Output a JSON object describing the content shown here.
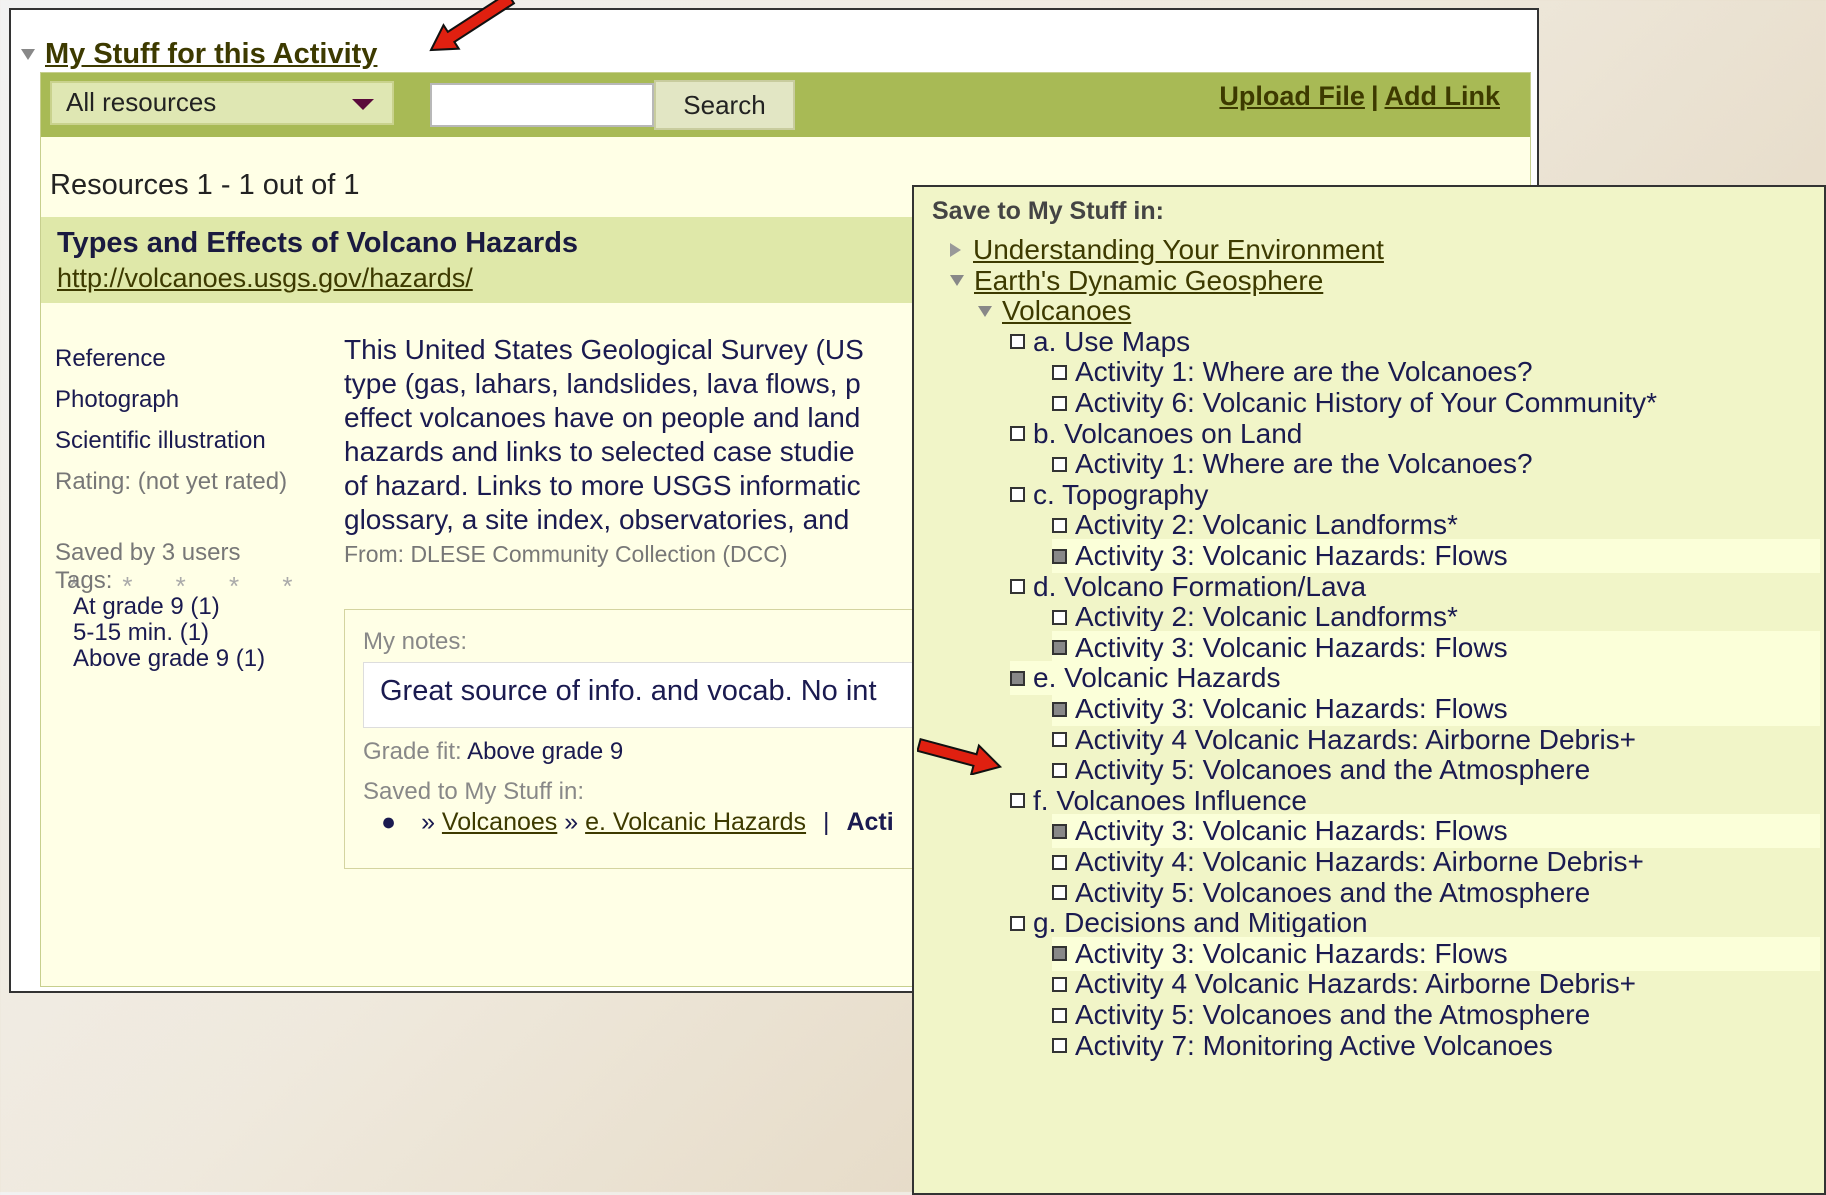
{
  "main": {
    "title": "My Stuff for this Activity",
    "toolbar": {
      "filter_value": "All resources",
      "search_value": "",
      "search_button": "Search",
      "upload_link": "Upload File",
      "separator": "|",
      "add_link": "Add Link"
    },
    "results_count": "Resources 1 - 1 out of 1",
    "result": {
      "title": "Types and Effects of Volcano Hazards",
      "url": "http://volcanoes.usgs.gov/hazards/",
      "types": [
        "Reference",
        "Photograph",
        "Scientific illustration"
      ],
      "rating": "Rating: (not yet rated)",
      "stars": "* * * * *",
      "rating_value": 0,
      "saved_by": "Saved by 3 users",
      "tags_label": "Tags:",
      "tags": [
        "At grade 9 (1)",
        "5-15 min. (1)",
        "Above grade 9 (1)"
      ],
      "description": "This United States Geological Survey (US\ntype (gas, lahars, landslides, lava flows, p\neffect volcanoes have on people and land\nhazards and links to selected case studie\nof hazard. Links to more USGS informatic\nglossary, a site index, observatories, and",
      "from": "From: DLESE Community Collection (DCC)",
      "notes": {
        "label": "My notes:",
        "text": "Great source of info. and vocab. No int",
        "grade_label": "Grade fit:",
        "grade_value": "Above grade 9",
        "saved_to_label": "Saved to My Stuff in:",
        "path_prefix": "»",
        "path_volcanoes": "Volcanoes",
        "path_sep": "»",
        "path_hazards": "e. Volcanic Hazards",
        "path_pipe": "|",
        "path_tail": "Acti"
      }
    }
  },
  "popup": {
    "title": "Save to My Stuff in:",
    "tree": [
      {
        "label": "Understanding Your Environment",
        "kind": "collapsed",
        "level": 0
      },
      {
        "label": "Earth's Dynamic Geosphere",
        "kind": "expanded",
        "level": 0
      },
      {
        "label": "Volcanoes",
        "kind": "expanded",
        "level": 1
      },
      {
        "label": "a. Use Maps",
        "kind": "check",
        "checked": false,
        "level": 2
      },
      {
        "label": "Activity 1: Where are the Volcanoes?",
        "kind": "check",
        "checked": false,
        "level": 3
      },
      {
        "label": "Activity 6: Volcanic History of Your Community*",
        "kind": "check",
        "checked": false,
        "level": 3
      },
      {
        "label": "b. Volcanoes on Land",
        "kind": "check",
        "checked": false,
        "level": 2
      },
      {
        "label": "Activity 1: Where are the Volcanoes?",
        "kind": "check",
        "checked": false,
        "level": 3
      },
      {
        "label": "c. Topography",
        "kind": "check",
        "checked": false,
        "level": 2
      },
      {
        "label": "Activity 2: Volcanic Landforms*",
        "kind": "check",
        "checked": false,
        "level": 3
      },
      {
        "label": "Activity 3: Volcanic Hazards: Flows",
        "kind": "check",
        "checked": true,
        "level": 3,
        "highlight": true
      },
      {
        "label": "d. Volcano Formation/Lava",
        "kind": "check",
        "checked": false,
        "level": 2
      },
      {
        "label": "Activity 2: Volcanic Landforms*",
        "kind": "check",
        "checked": false,
        "level": 3
      },
      {
        "label": "Activity 3: Volcanic Hazards: Flows",
        "kind": "check",
        "checked": true,
        "level": 3,
        "highlight": true
      },
      {
        "label": "e. Volcanic Hazards",
        "kind": "check",
        "checked": true,
        "level": 2,
        "highlight": true
      },
      {
        "label": "Activity 3: Volcanic Hazards: Flows",
        "kind": "check",
        "checked": true,
        "level": 3,
        "highlight": true
      },
      {
        "label": "Activity 4 Volcanic Hazards: Airborne Debris+",
        "kind": "check",
        "checked": false,
        "level": 3
      },
      {
        "label": "Activity 5: Volcanoes and the Atmosphere",
        "kind": "check",
        "checked": false,
        "level": 3
      },
      {
        "label": "f. Volcanoes Influence",
        "kind": "check",
        "checked": false,
        "level": 2
      },
      {
        "label": "Activity 3: Volcanic Hazards: Flows",
        "kind": "check",
        "checked": true,
        "level": 3,
        "highlight": true
      },
      {
        "label": "Activity 4: Volcanic Hazards: Airborne Debris+",
        "kind": "check",
        "checked": false,
        "level": 3
      },
      {
        "label": "Activity 5: Volcanoes and the Atmosphere",
        "kind": "check",
        "checked": false,
        "level": 3
      },
      {
        "label": "g. Decisions and Mitigation",
        "kind": "check",
        "checked": false,
        "level": 2
      },
      {
        "label": "Activity 3: Volcanic Hazards: Flows",
        "kind": "check",
        "checked": true,
        "level": 3,
        "highlight": true
      },
      {
        "label": "Activity 4 Volcanic Hazards: Airborne Debris+",
        "kind": "check",
        "checked": false,
        "level": 3
      },
      {
        "label": "Activity 5: Volcanoes and the Atmosphere",
        "kind": "check",
        "checked": false,
        "level": 3
      },
      {
        "label": "Activity 7: Monitoring Active Volcanoes",
        "kind": "check",
        "checked": false,
        "level": 3
      }
    ]
  },
  "colors": {
    "toolbar": "#a8ba55",
    "panel": "#ffffe6",
    "popup": "#f1f5c8",
    "arrow": "#e02010",
    "link": "#3d3a00"
  }
}
